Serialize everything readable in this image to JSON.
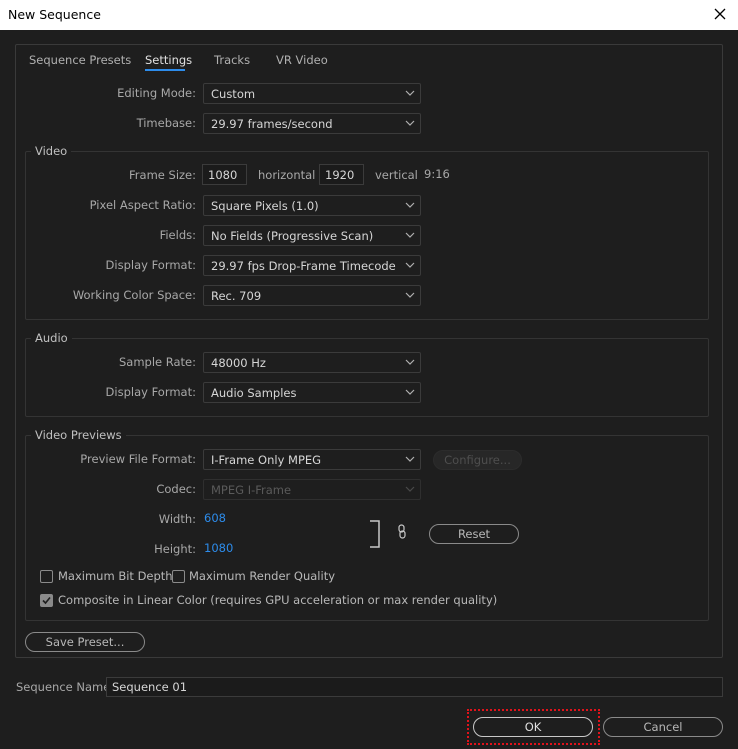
{
  "window": {
    "title": "New Sequence"
  },
  "tabs": [
    {
      "label": "Sequence Presets"
    },
    {
      "label": "Settings"
    },
    {
      "label": "Tracks"
    },
    {
      "label": "VR Video"
    }
  ],
  "settings": {
    "editing_mode": {
      "label": "Editing Mode:",
      "value": "Custom"
    },
    "timebase": {
      "label": "Timebase:",
      "value": "29.97  frames/second"
    }
  },
  "video": {
    "title": "Video",
    "frame_size": {
      "label": "Frame Size:",
      "width": "1080",
      "horizontal_label": "horizontal",
      "height": "1920",
      "vertical_label": "vertical",
      "aspect": "9:16"
    },
    "pixel_aspect_ratio": {
      "label": "Pixel Aspect Ratio:",
      "value": "Square Pixels (1.0)"
    },
    "fields": {
      "label": "Fields:",
      "value": "No Fields (Progressive Scan)"
    },
    "display_format": {
      "label": "Display Format:",
      "value": "29.97 fps Drop-Frame Timecode"
    },
    "working_color_space": {
      "label": "Working Color Space:",
      "value": "Rec. 709"
    }
  },
  "audio": {
    "title": "Audio",
    "sample_rate": {
      "label": "Sample Rate:",
      "value": "48000 Hz"
    },
    "display_format": {
      "label": "Display Format:",
      "value": "Audio Samples"
    }
  },
  "video_previews": {
    "title": "Video Previews",
    "preview_file_format": {
      "label": "Preview File Format:",
      "value": "I-Frame Only MPEG"
    },
    "configure_label": "Configure...",
    "codec": {
      "label": "Codec:",
      "value": "MPEG I-Frame"
    },
    "width": {
      "label": "Width:",
      "value": "608"
    },
    "height": {
      "label": "Height:",
      "value": "1080"
    },
    "reset_label": "Reset",
    "max_bit_depth": {
      "label": "Maximum Bit Depth",
      "checked": false
    },
    "max_render_quality": {
      "label": "Maximum Render Quality",
      "checked": false
    },
    "composite_linear": {
      "label": "Composite in Linear Color (requires GPU acceleration or max render quality)",
      "checked": true
    }
  },
  "save_preset_label": "Save Preset...",
  "sequence_name": {
    "label": "Sequence Name:",
    "value": "Sequence 01"
  },
  "ok_label": "OK",
  "cancel_label": "Cancel",
  "colors": {
    "accent": "#2d8ceb",
    "background": "#1e1e1e",
    "highlight": "#e0131b"
  }
}
